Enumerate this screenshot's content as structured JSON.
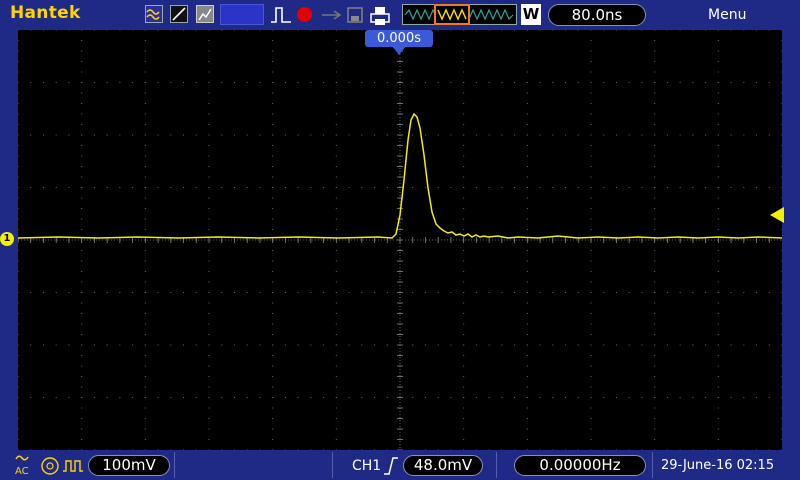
{
  "brand": "Hantek",
  "topbar": {
    "timebase": "80.0ns",
    "mode_letter": "W",
    "menu_label": "Menu"
  },
  "display": {
    "trigger_position": "0.000s",
    "channel_marker": "1"
  },
  "bottombar": {
    "coupling": "AC",
    "volts_div": "100mV",
    "trigger_source": "CH1",
    "trigger_level": "48.0mV",
    "frequency": "0.00000Hz",
    "datetime": "29-June-16 02:15"
  },
  "colors": {
    "trace": "#f2f000",
    "background": "#1f2a86",
    "brand": "#ffd400",
    "grid": "#6a6a6a"
  },
  "icons": [
    "wave-icon",
    "slope-icon",
    "gray-icon",
    "run-pulse-icon",
    "record-icon",
    "usb-icon",
    "save-icon",
    "print-icon",
    "trigger-rising-edge-icon"
  ]
}
